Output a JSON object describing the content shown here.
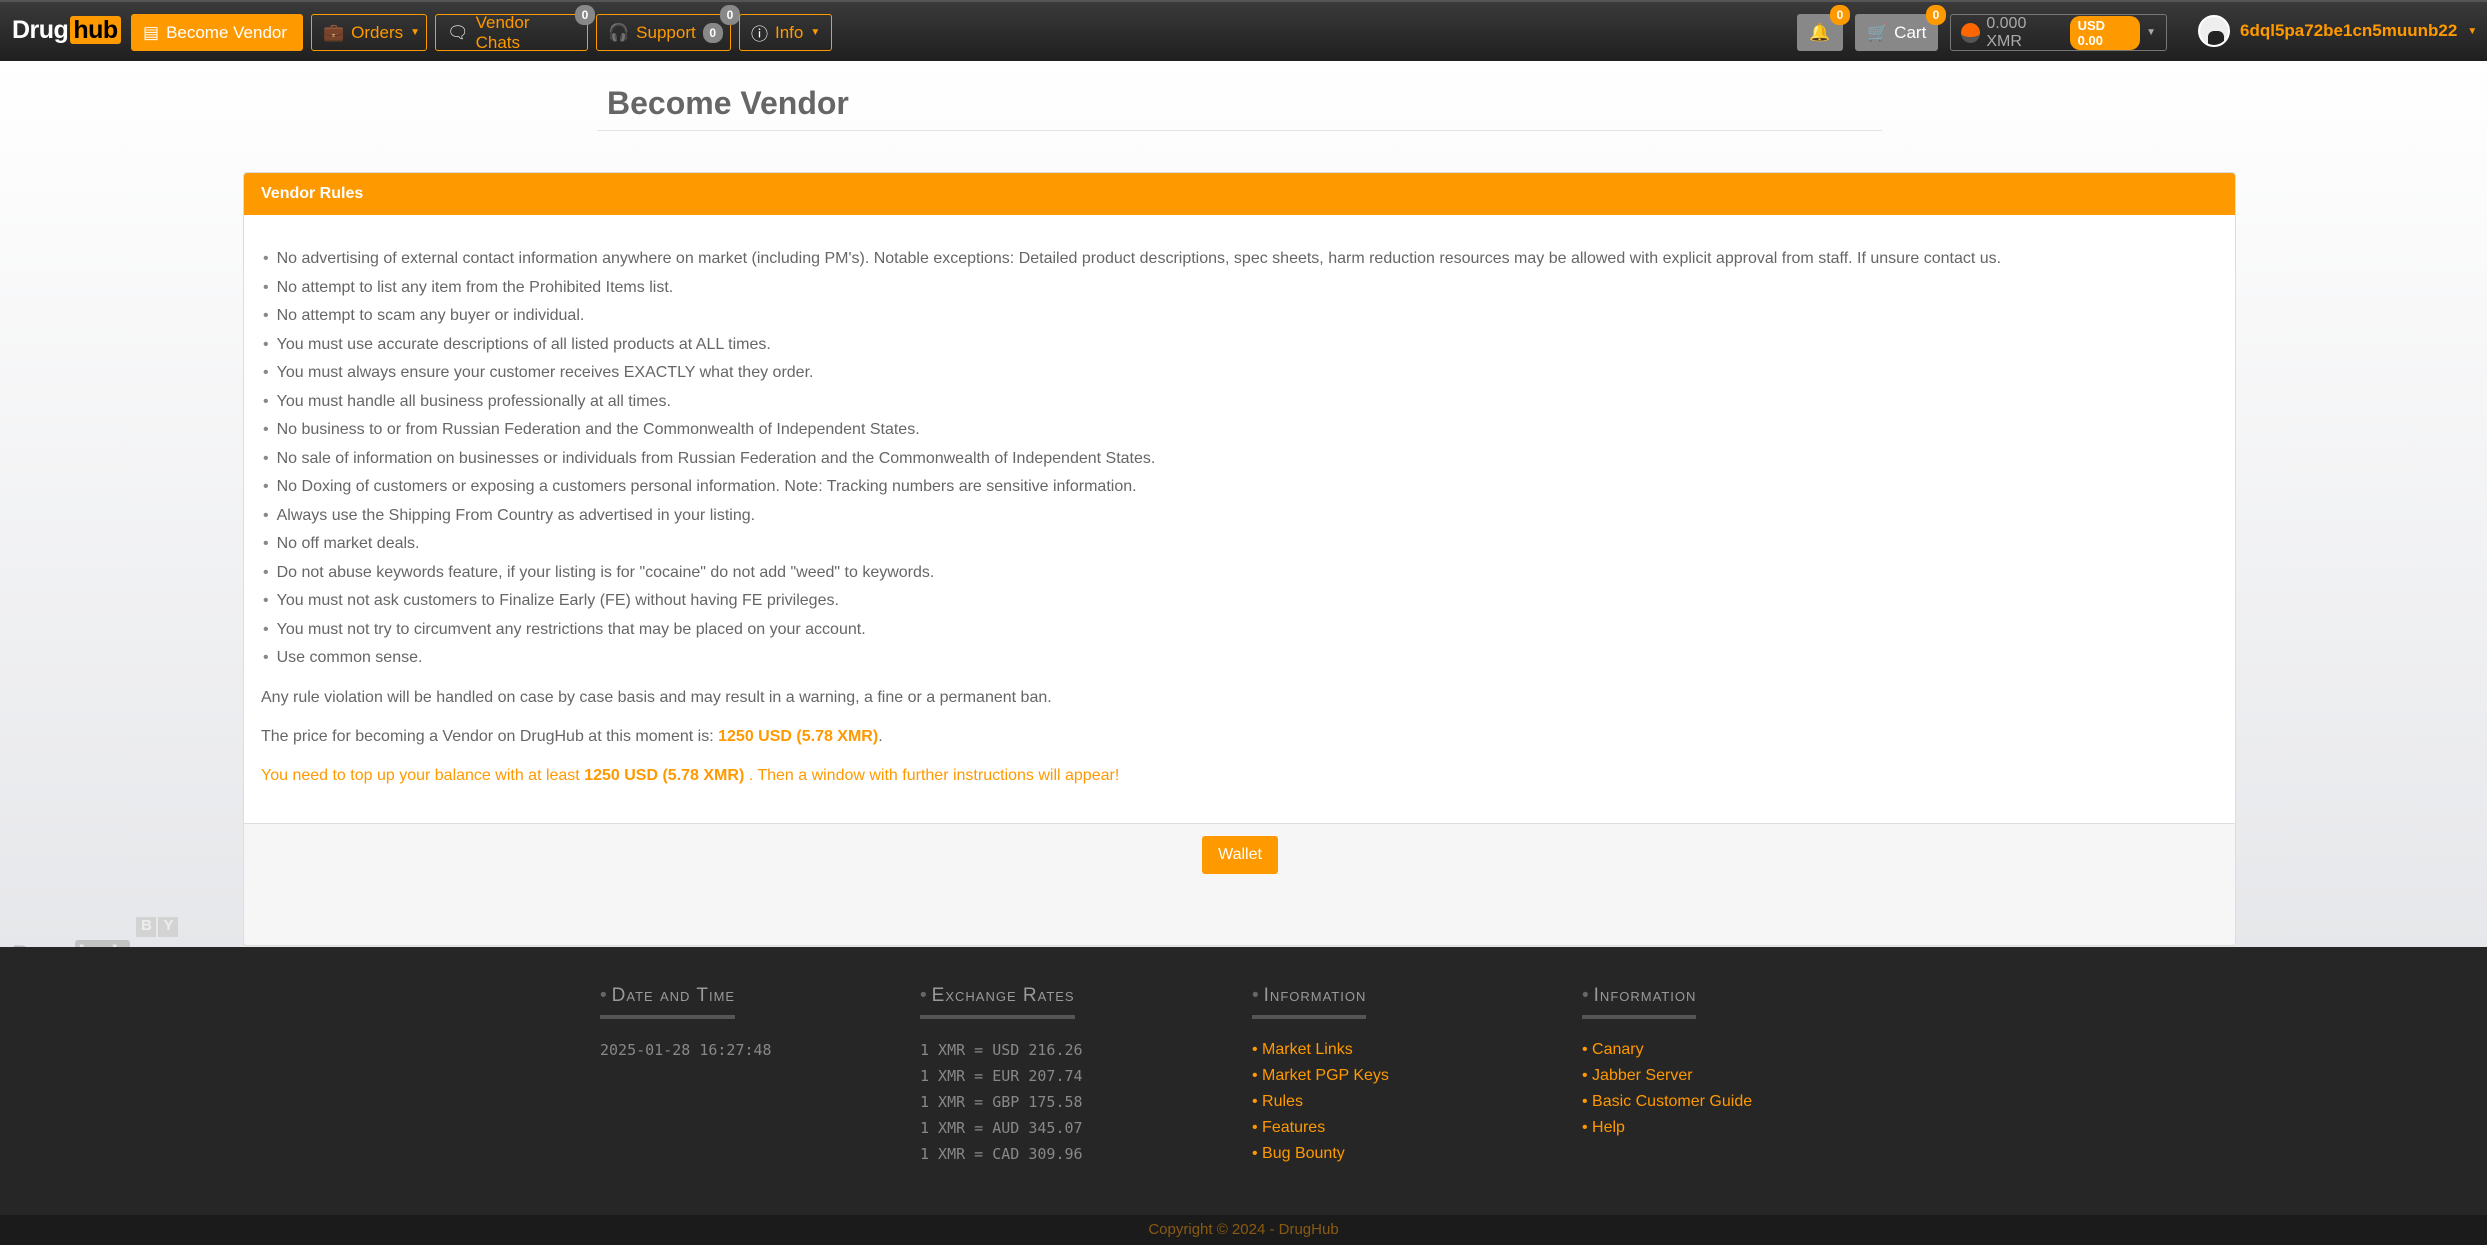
{
  "nav": {
    "logo": "Drug",
    "logo_hub": "hub",
    "become_vendor": "Become Vendor",
    "orders": "Orders",
    "vendor_chats": "Vendor Chats",
    "vendor_chats_badge": "0",
    "support": "Support",
    "support_badge": "0",
    "support_badge_top": "0",
    "info": "Info",
    "notifications_badge": "0",
    "cart": "Cart",
    "cart_badge": "0",
    "balance": "0.000 XMR",
    "balance_usd": "USD 0.00",
    "username": "6dql5pa72be1cn5muunb22"
  },
  "page": {
    "title": "Become Vendor"
  },
  "panel": {
    "header": "Vendor Rules",
    "rules": [
      "No advertising of external contact information anywhere on market (including PM's). Notable exceptions: Detailed product descriptions, spec sheets, harm reduction resources may be allowed with explicit approval from staff. If unsure contact us.",
      "No attempt to list any item from the Prohibited Items list.",
      "No attempt to scam any buyer or individual.",
      "You must use accurate descriptions of all listed products at ALL times.",
      "You must always ensure your customer receives EXACTLY what they order.",
      "You must handle all business professionally at all times.",
      "No business to or from Russian Federation and the Commonwealth of Independent States.",
      "No sale of information on businesses or individuals from Russian Federation and the Commonwealth of Independent States.",
      "No Doxing of customers or exposing a customers personal information. Note: Tracking numbers are sensitive information.",
      "Always use the Shipping From Country as advertised in your listing.",
      "No off market deals.",
      "Do not abuse keywords feature, if your listing is for \"cocaine\" do not add \"weed\" to keywords.",
      "You must not ask customers to Finalize Early (FE) without having FE privileges.",
      "You must not try to circumvent any restrictions that may be placed on your account.",
      "Use common sense."
    ],
    "violation": "Any rule violation will be handled on case by case basis and may result in a warning, a fine or a permanent ban.",
    "price_prefix": "The price for becoming a Vendor on DrugHub at this moment is: ",
    "price": "1250 USD (5.78 XMR)",
    "price_suffix": ".",
    "topup_prefix": "You need to top up your balance with at least ",
    "topup_amount": "1250 USD (5.78 XMR)",
    "topup_suffix": " . Then a window with further instructions will appear!",
    "wallet_button": "Wallet"
  },
  "watermark": {
    "text": "Drug",
    "hub": "hub",
    "by": [
      "B",
      "Y"
    ],
    "whm": [
      "W",
      "H",
      "M"
    ]
  },
  "footer": {
    "date_heading": "Date and Time",
    "datetime": "2025-01-28 16:27:48",
    "rates_heading": "Exchange Rates",
    "rates": [
      "1 XMR = USD 216.26",
      "1 XMR = EUR 207.74",
      "1 XMR = GBP 175.58",
      "1 XMR = AUD 345.07",
      "1 XMR = CAD 309.96"
    ],
    "info1_heading": "Information",
    "info1": [
      "Market Links",
      "Market PGP Keys",
      "Rules",
      "Features",
      "Bug Bounty"
    ],
    "info2_heading": "Information",
    "info2": [
      "Canary",
      "Jabber Server",
      "Basic Customer Guide",
      "Help"
    ],
    "copyright": "Copyright © 2024 - DrugHub"
  },
  "colors": {
    "accent": "#ff9900",
    "navbar": "#262626",
    "footer": "#262626"
  }
}
